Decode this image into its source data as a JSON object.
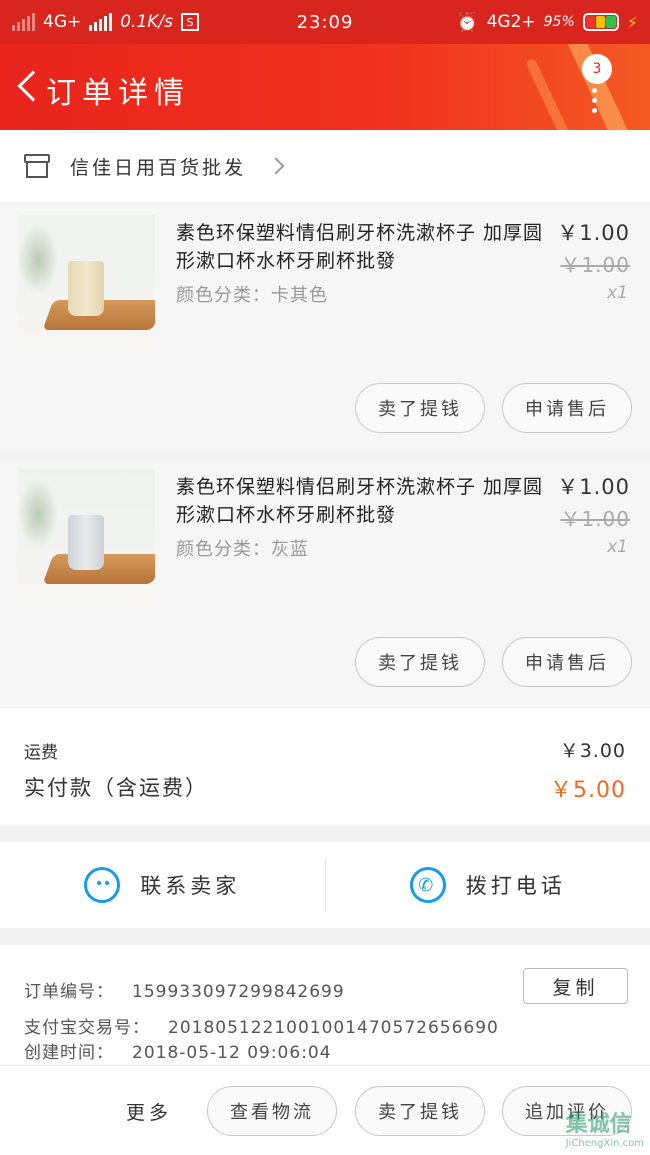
{
  "status_bar": {
    "network_left": "4G+",
    "speed": "0.1K/s",
    "s_icon": "S",
    "time": "23:09",
    "network_right": "4G2+",
    "battery": "95%"
  },
  "header": {
    "title": "订单详情",
    "badge": "3",
    "colors": {
      "accent": "#e8241c"
    }
  },
  "shop": {
    "name": "信佳日用百货批发"
  },
  "items": [
    {
      "title": "素色环保塑料情侣刷牙杯洗漱杯子 加厚圆形漱口杯水杯牙刷杯批發",
      "spec": "颜色分类：卡其色",
      "price": "￥1.00",
      "original_price": "￥1.00",
      "qty": "x1",
      "cup_color": "#efe3c6",
      "btn_remind": "卖了提钱",
      "btn_aftersale": "申请售后"
    },
    {
      "title": "素色环保塑料情侣刷牙杯洗漱杯子 加厚圆形漱口杯水杯牙刷杯批發",
      "spec": "颜色分类：灰蓝",
      "price": "￥1.00",
      "original_price": "￥1.00",
      "qty": "x1",
      "cup_color": "#dcdfe0",
      "btn_remind": "卖了提钱",
      "btn_aftersale": "申请售后"
    }
  ],
  "totals": {
    "shipping_label": "运费",
    "shipping_value": "￥3.00",
    "paid_label": "实付款（含运费）",
    "paid_value": "￥5.00"
  },
  "contact": {
    "seller_label": "联系卖家",
    "phone_label": "拨打电话"
  },
  "order_info": {
    "order_no_label": "订单编号：",
    "order_no": "159933097299842699",
    "copy_label": "复制",
    "alipay_label": "支付宝交易号：",
    "alipay_no": "2018051221001001470572656690",
    "created_label": "创建时间：",
    "created_time": "2018-05-12 09:06:04"
  },
  "bottom_bar": {
    "more_label": "更多",
    "logistics_label": "查看物流",
    "remind_label": "卖了提钱",
    "review_label": "追加评价",
    "watermark": "集诚信",
    "watermark_url": "JiChengXin.com"
  }
}
